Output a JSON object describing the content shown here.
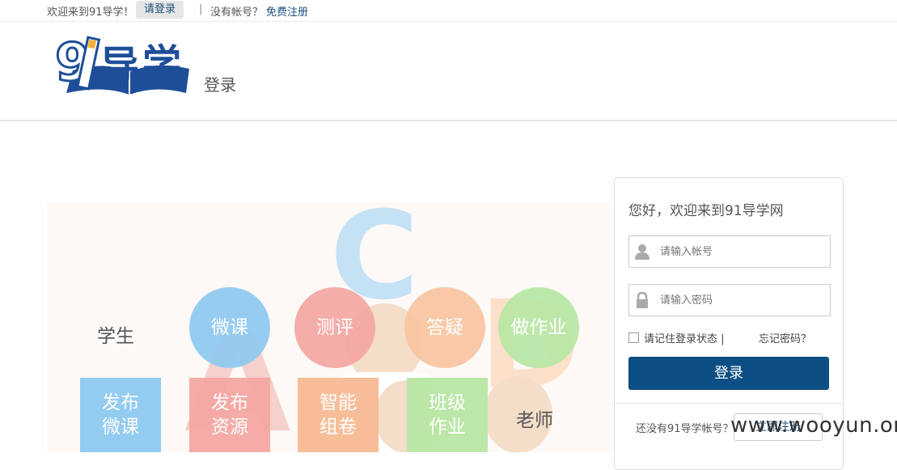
{
  "topbar": {
    "welcome": "欢迎来到91导学！",
    "login_link": "请登录",
    "separator": "|",
    "no_account": "没有帐号？",
    "register_link": "免费注册"
  },
  "header": {
    "logo_text": "91导学",
    "page_title": "登录"
  },
  "banner": {
    "letters": [
      "C",
      "A",
      "D"
    ],
    "student_label": "学生",
    "teacher_label": "老师",
    "student_features": [
      {
        "label": "微课",
        "color": "#8ec8f0"
      },
      {
        "label": "测评",
        "color": "#f4a6a2"
      },
      {
        "label": "答疑",
        "color": "#f7c3a0"
      },
      {
        "label": "做作业",
        "color": "#b7e6a4"
      }
    ],
    "teacher_features": [
      {
        "line1": "发布",
        "line2": "微课",
        "color": "#8ec8f0"
      },
      {
        "line1": "发布",
        "line2": "资源",
        "color": "#f4a6a2"
      },
      {
        "line1": "智能",
        "line2": "组卷",
        "color": "#f7b993"
      },
      {
        "line1": "班级",
        "line2": "作业",
        "color": "#b7e6a4"
      }
    ]
  },
  "login": {
    "greeting": "您好，欢迎来到91导学网",
    "account_placeholder": "请输入帐号",
    "password_placeholder": "请输入密码",
    "remember_label": "请记住登录状态 |",
    "forgot_label": "忘记密码？",
    "login_button": "登录",
    "no_account": "还没有91导学帐号？",
    "register_button": "立即注册"
  },
  "watermark": "www.wooyun.org"
}
